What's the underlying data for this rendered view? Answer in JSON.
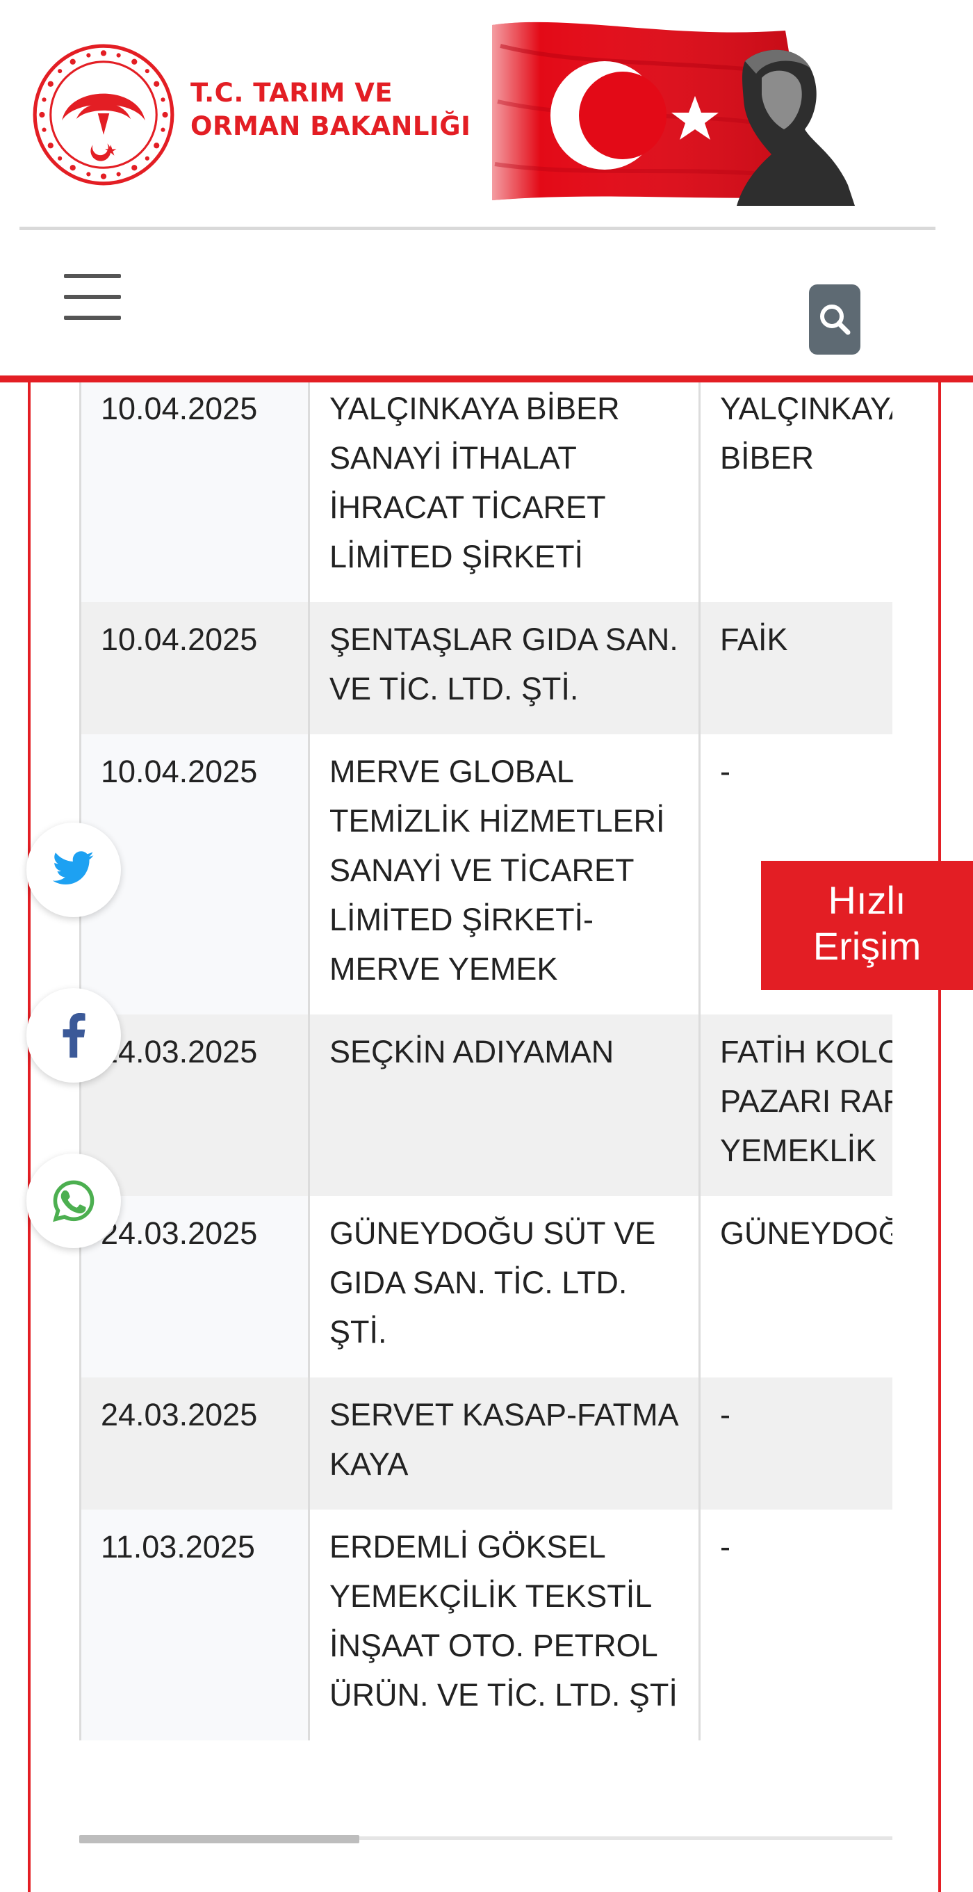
{
  "header": {
    "ministry_line1": "T.C. TARIM VE",
    "ministry_line2": "ORMAN BAKANLIĞI",
    "menu_icon": "hamburger-menu-icon",
    "search_icon": "search-icon"
  },
  "colors": {
    "brand_red": "#e31e24",
    "search_bg": "#5e6a73",
    "twitter_blue": "#1da1f2",
    "facebook_navy": "#3b5998",
    "whatsapp_green": "#4caf50"
  },
  "table": {
    "rows": [
      {
        "date": "10.04.2025",
        "company": "YALÇINKAYA BİBER SANAYİ İTHALAT İHRACAT TİCARET LİMİTED ŞİRKETİ",
        "other": "YALÇINKAYA HALİS BİBER"
      },
      {
        "date": "10.04.2025",
        "company": "ŞENTAŞLAR GIDA SAN. VE TİC. LTD. ŞTİ.",
        "other": "FAİK"
      },
      {
        "date": "10.04.2025",
        "company": "MERVE GLOBAL TEMİZLİK HİZMETLERİ SANAYİ VE TİCARET LİMİTED ŞİRKETİ-MERVE YEMEK",
        "other": "-"
      },
      {
        "date": "24.03.2025",
        "company": "SEÇKİN ADIYAMAN",
        "other": "FATİH KOLCU EGE PAZARI RAFİNE YEMEKLİK"
      },
      {
        "date": "24.03.2025",
        "company": "GÜNEYDOĞU SÜT VE GIDA SAN. TİC. LTD. ŞTİ.",
        "other": "GÜNEYDOĞU"
      },
      {
        "date": "24.03.2025",
        "company": "SERVET KASAP-FATMA KAYA",
        "other": "-"
      },
      {
        "date": "11.03.2025",
        "company": "ERDEMLİ GÖKSEL YEMEKÇİLİK TEKSTİL İNŞAAT OTO. PETROL ÜRÜN. VE TİC. LTD. ŞTİ",
        "other": "-"
      }
    ]
  },
  "social": {
    "twitter_icon": "twitter-icon",
    "facebook_icon": "facebook-icon",
    "whatsapp_icon": "whatsapp-icon"
  },
  "quick_access": {
    "line1": "Hızlı",
    "line2": "Erişim"
  },
  "scrollbar": {
    "position_fraction": 0.0,
    "visible_fraction": 0.34
  }
}
